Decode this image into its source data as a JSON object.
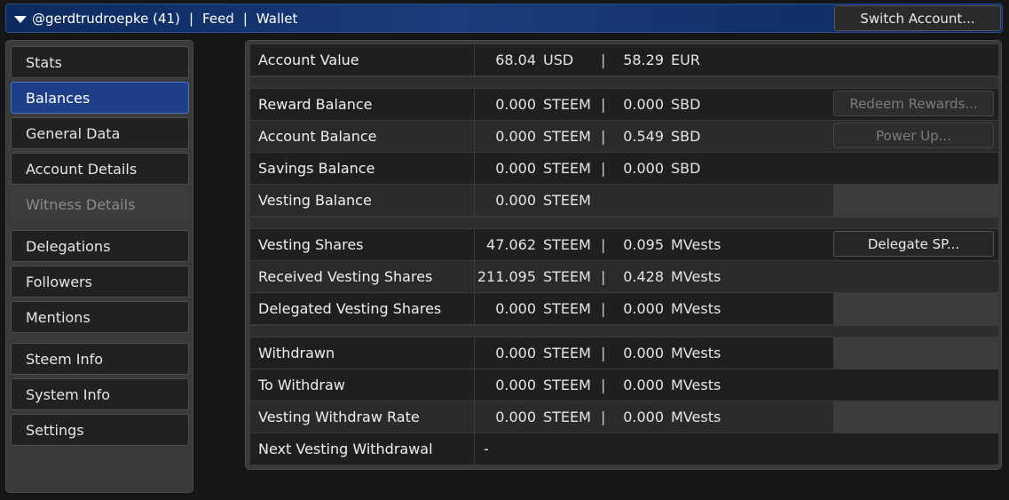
{
  "topbar": {
    "account": "@gerdtrudroepke (41)",
    "sep1": "|",
    "feed": "Feed",
    "sep2": "|",
    "wallet": "Wallet",
    "switch_label": "Switch Account..."
  },
  "sidebar": {
    "items": [
      {
        "label": "Stats"
      },
      {
        "label": "Balances"
      },
      {
        "label": "General Data"
      },
      {
        "label": "Account Details"
      },
      {
        "label": "Witness Details"
      },
      {
        "label": "Delegations"
      },
      {
        "label": "Followers"
      },
      {
        "label": "Mentions"
      },
      {
        "label": "Steem Info"
      },
      {
        "label": "System Info"
      },
      {
        "label": "Settings"
      }
    ]
  },
  "wallet": {
    "account_value": {
      "label": "Account Value",
      "v1": "68.04",
      "u1": "USD",
      "bar": "|",
      "v2": "58.29",
      "u2": "EUR"
    },
    "reward_balance": {
      "label": "Reward Balance",
      "v1": "0.000",
      "u1": "STEEM",
      "bar": "|",
      "v2": "0.000",
      "u2": "SBD",
      "button": "Redeem Rewards..."
    },
    "account_balance": {
      "label": "Account Balance",
      "v1": "0.000",
      "u1": "STEEM",
      "bar": "|",
      "v2": "0.549",
      "u2": "SBD",
      "button": "Power Up..."
    },
    "savings_balance": {
      "label": "Savings Balance",
      "v1": "0.000",
      "u1": "STEEM",
      "bar": "|",
      "v2": "0.000",
      "u2": "SBD"
    },
    "vesting_balance": {
      "label": "Vesting Balance",
      "v1": "0.000",
      "u1": "STEEM"
    },
    "vesting_shares": {
      "label": "Vesting Shares",
      "v1": "47.062",
      "u1": "STEEM",
      "bar": "|",
      "v2": "0.095",
      "u2": "MVests",
      "button": "Delegate SP..."
    },
    "received_vesting": {
      "label": "Received Vesting Shares",
      "v1": "211.095",
      "u1": "STEEM",
      "bar": "|",
      "v2": "0.428",
      "u2": "MVests"
    },
    "delegated_vesting": {
      "label": "Delegated Vesting Shares",
      "v1": "0.000",
      "u1": "STEEM",
      "bar": "|",
      "v2": "0.000",
      "u2": "MVests"
    },
    "withdrawn": {
      "label": "Withdrawn",
      "v1": "0.000",
      "u1": "STEEM",
      "bar": "|",
      "v2": "0.000",
      "u2": "MVests"
    },
    "to_withdraw": {
      "label": "To Withdraw",
      "v1": "0.000",
      "u1": "STEEM",
      "bar": "|",
      "v2": "0.000",
      "u2": "MVests"
    },
    "withdraw_rate": {
      "label": "Vesting Withdraw Rate",
      "v1": "0.000",
      "u1": "STEEM",
      "bar": "|",
      "v2": "0.000",
      "u2": "MVests"
    },
    "next_withdrawal": {
      "label": "Next Vesting Withdrawal",
      "value": "-"
    }
  },
  "colors": {
    "accent": "#1d3f8a",
    "topbar": "#0c2a5e",
    "background": "#161616"
  }
}
